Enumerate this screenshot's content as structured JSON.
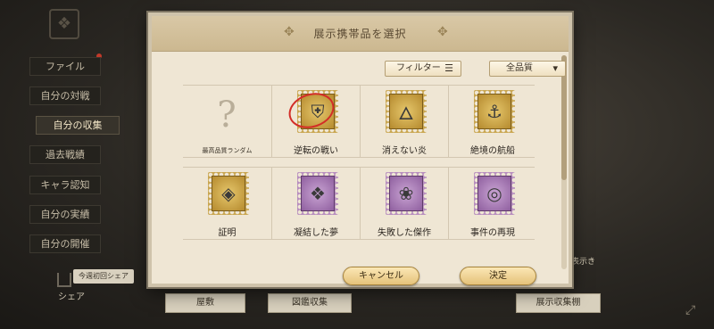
{
  "background": {
    "logo_glyph": "❖",
    "menu": [
      {
        "label": "ファイル"
      },
      {
        "label": "自分の対戦"
      },
      {
        "label": "自分の収集"
      },
      {
        "label": "過去戦績"
      },
      {
        "label": "キャラ認知"
      },
      {
        "label": "自分の実績"
      },
      {
        "label": "自分の開催"
      }
    ],
    "share_tip": "今週初回シェア",
    "share_label": "シェア",
    "tabs": [
      {
        "label": "屋敷"
      },
      {
        "label": "図鑑収集"
      },
      {
        "label": "展示収集棚"
      }
    ],
    "side_text": "表示き",
    "colors": {
      "notify_dot": "#c23a2a"
    }
  },
  "modal": {
    "title": "展示携帯品を選択",
    "filter_label": "フィルター",
    "filter_icon": "list-icon",
    "quality_label": "全品質",
    "quality_icon": "chevron-down-icon",
    "items_row1": [
      {
        "name": "最高品質ランダム",
        "icon": "question-mark",
        "style": "none"
      },
      {
        "name": "逆転の戦い",
        "icon": "helmet-icon",
        "style": "gold"
      },
      {
        "name": "消えない炎",
        "icon": "torch-icon",
        "style": "gold"
      },
      {
        "name": "絶境の航船",
        "icon": "ship-icon",
        "style": "gold"
      }
    ],
    "items_row2": [
      {
        "name": "証明",
        "icon": "badge-icon",
        "style": "gold"
      },
      {
        "name": "凝結した夢",
        "icon": "crystal-icon",
        "style": "purple"
      },
      {
        "name": "失敗した傑作",
        "icon": "sculpture-icon",
        "style": "purple"
      },
      {
        "name": "事件の再現",
        "icon": "target-icon",
        "style": "purple"
      }
    ],
    "cancel_label": "キャンセル",
    "confirm_label": "決定",
    "colors": {
      "highlight_circle": "#d32d27",
      "button_gold": "#e5c27a"
    }
  }
}
